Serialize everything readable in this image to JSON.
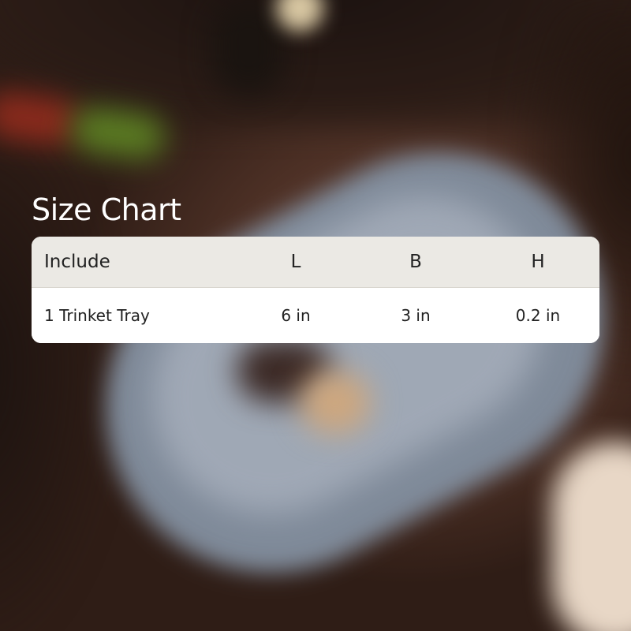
{
  "size_chart": {
    "title": "Size Chart",
    "columns": {
      "include": "Include",
      "length": "L",
      "breadth": "B",
      "height": "H"
    },
    "rows": [
      {
        "include": "1 Trinket Tray",
        "length": "6 in",
        "breadth": "3 in",
        "height": "0.2 in"
      }
    ]
  },
  "colors": {
    "header_background": "#ebe9e4",
    "row_background": "#ffffff",
    "title_text": "#ffffff",
    "table_text": "#222222"
  }
}
